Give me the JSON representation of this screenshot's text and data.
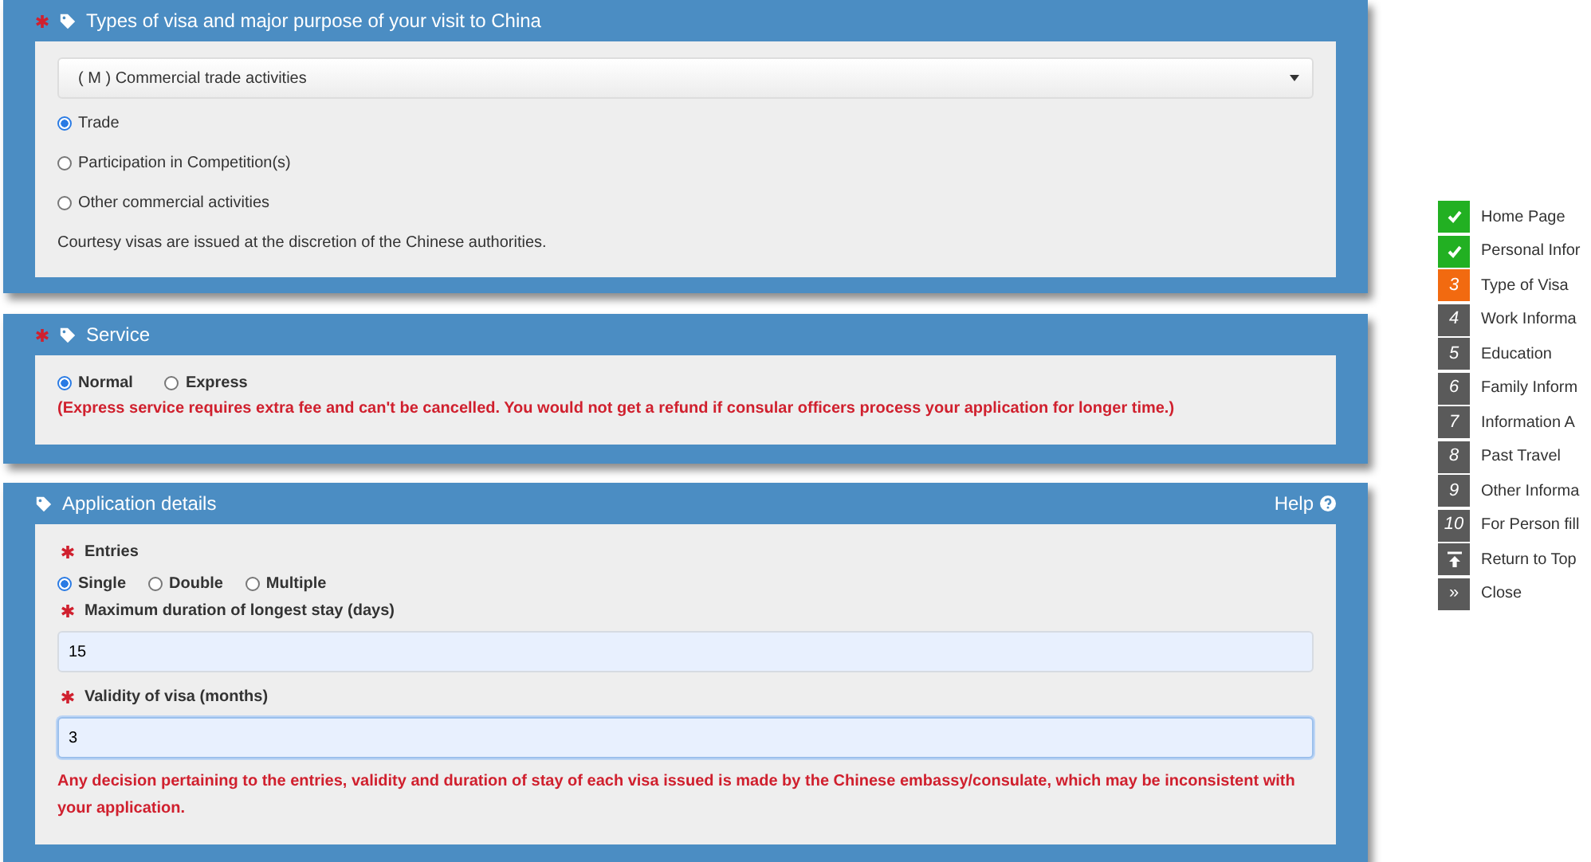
{
  "visa_type_panel": {
    "title": "Types of visa and major purpose of your visit to China",
    "required": true,
    "select": {
      "value": "( M ) Commercial trade activities"
    },
    "options": [
      {
        "label": "Trade",
        "selected": true
      },
      {
        "label": "Participation in Competition(s)",
        "selected": false
      },
      {
        "label": "Other commercial activities",
        "selected": false
      }
    ],
    "note": "Courtesy visas are issued at the discretion of the Chinese authorities."
  },
  "service_panel": {
    "title": "Service",
    "required": true,
    "options": [
      {
        "label": "Normal",
        "selected": true
      },
      {
        "label": "Express",
        "selected": false
      }
    ],
    "warning": "(Express service requires extra fee and can't be cancelled. You would not get a refund if consular officers process your application for longer time.)"
  },
  "application_panel": {
    "title": "Application details",
    "help": "Help",
    "entries": {
      "label": "Entries",
      "required": true,
      "options": [
        {
          "label": "Single",
          "selected": true
        },
        {
          "label": "Double",
          "selected": false
        },
        {
          "label": "Multiple",
          "selected": false
        }
      ]
    },
    "fields": [
      {
        "label": "Maximum duration of longest stay (days)",
        "required": true,
        "value": "15",
        "focused": false
      },
      {
        "label": "Validity of visa (months)",
        "required": true,
        "value": "3",
        "focused": true
      }
    ],
    "warning": "Any decision pertaining to the entries, validity and duration of stay of each visa issued is made by the Chinese embassy/consulate, which may be inconsistent with your application."
  },
  "steps": [
    {
      "kind": "done",
      "label": "Home Page"
    },
    {
      "kind": "done",
      "label": "Personal Infor"
    },
    {
      "kind": "current",
      "marker": "3",
      "label": "Type of Visa"
    },
    {
      "kind": "pending",
      "marker": "4",
      "label": "Work Informa"
    },
    {
      "kind": "pending",
      "marker": "5",
      "label": "Education"
    },
    {
      "kind": "pending",
      "marker": "6",
      "label": "Family Inform"
    },
    {
      "kind": "pending",
      "marker": "7",
      "label": "Information A"
    },
    {
      "kind": "pending",
      "marker": "8",
      "label": "Past Travel"
    },
    {
      "kind": "pending",
      "marker": "9",
      "label": "Other Informa"
    },
    {
      "kind": "pending",
      "marker": "10",
      "label": "For Person fill"
    },
    {
      "kind": "top",
      "label": "Return to Top"
    },
    {
      "kind": "close",
      "marker": "»",
      "label": "Close"
    }
  ]
}
